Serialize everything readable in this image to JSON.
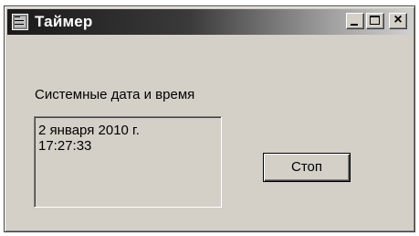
{
  "window": {
    "title": "Таймер",
    "icon": "form-icon",
    "controls": {
      "minimize_icon": "minimize-icon",
      "maximize_icon": "maximize-icon",
      "close_glyph": "×"
    }
  },
  "main": {
    "label": "Системные дата и время",
    "date_line": "2 января 2010 г.",
    "time_line": "17:27:33",
    "stop_button_label": "Стоп"
  }
}
